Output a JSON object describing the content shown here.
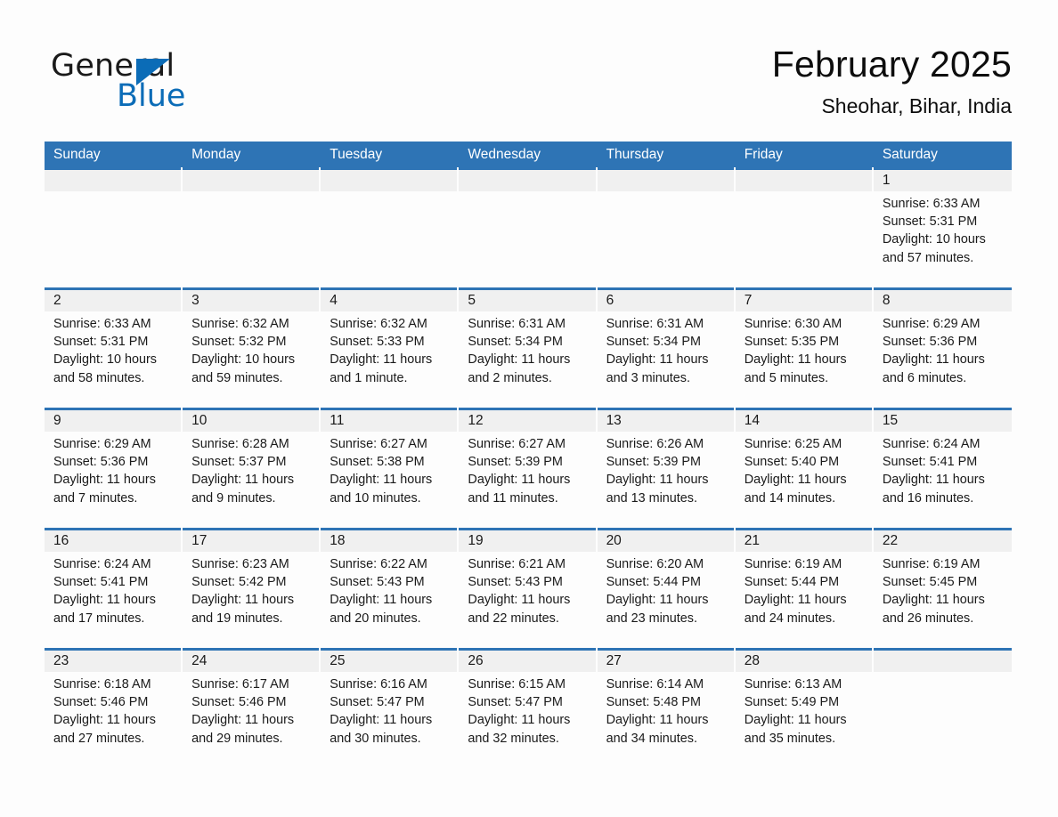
{
  "logo": {
    "text_primary": "General",
    "text_secondary": "Blue",
    "triangle_color": "#0b6cb7"
  },
  "header": {
    "title": "February 2025",
    "subtitle": "Sheohar, Bihar, India"
  },
  "theme": {
    "header_blue": "#2e74b5",
    "date_strip_gray": "#f0f0f0",
    "page_background": "#fdfdfd",
    "text_color": "#1a1a1a"
  },
  "weekdays": [
    "Sunday",
    "Monday",
    "Tuesday",
    "Wednesday",
    "Thursday",
    "Friday",
    "Saturday"
  ],
  "labels": {
    "sunrise_prefix": "Sunrise:",
    "sunset_prefix": "Sunset:",
    "daylight_prefix": "Daylight:"
  },
  "weeks": [
    [
      {
        "day": "",
        "sunrise": "",
        "sunset": "",
        "daylight": ""
      },
      {
        "day": "",
        "sunrise": "",
        "sunset": "",
        "daylight": ""
      },
      {
        "day": "",
        "sunrise": "",
        "sunset": "",
        "daylight": ""
      },
      {
        "day": "",
        "sunrise": "",
        "sunset": "",
        "daylight": ""
      },
      {
        "day": "",
        "sunrise": "",
        "sunset": "",
        "daylight": ""
      },
      {
        "day": "",
        "sunrise": "",
        "sunset": "",
        "daylight": ""
      },
      {
        "day": "1",
        "sunrise": "Sunrise: 6:33 AM",
        "sunset": "Sunset: 5:31 PM",
        "daylight": "Daylight: 10 hours and 57 minutes."
      }
    ],
    [
      {
        "day": "2",
        "sunrise": "Sunrise: 6:33 AM",
        "sunset": "Sunset: 5:31 PM",
        "daylight": "Daylight: 10 hours and 58 minutes."
      },
      {
        "day": "3",
        "sunrise": "Sunrise: 6:32 AM",
        "sunset": "Sunset: 5:32 PM",
        "daylight": "Daylight: 10 hours and 59 minutes."
      },
      {
        "day": "4",
        "sunrise": "Sunrise: 6:32 AM",
        "sunset": "Sunset: 5:33 PM",
        "daylight": "Daylight: 11 hours and 1 minute."
      },
      {
        "day": "5",
        "sunrise": "Sunrise: 6:31 AM",
        "sunset": "Sunset: 5:34 PM",
        "daylight": "Daylight: 11 hours and 2 minutes."
      },
      {
        "day": "6",
        "sunrise": "Sunrise: 6:31 AM",
        "sunset": "Sunset: 5:34 PM",
        "daylight": "Daylight: 11 hours and 3 minutes."
      },
      {
        "day": "7",
        "sunrise": "Sunrise: 6:30 AM",
        "sunset": "Sunset: 5:35 PM",
        "daylight": "Daylight: 11 hours and 5 minutes."
      },
      {
        "day": "8",
        "sunrise": "Sunrise: 6:29 AM",
        "sunset": "Sunset: 5:36 PM",
        "daylight": "Daylight: 11 hours and 6 minutes."
      }
    ],
    [
      {
        "day": "9",
        "sunrise": "Sunrise: 6:29 AM",
        "sunset": "Sunset: 5:36 PM",
        "daylight": "Daylight: 11 hours and 7 minutes."
      },
      {
        "day": "10",
        "sunrise": "Sunrise: 6:28 AM",
        "sunset": "Sunset: 5:37 PM",
        "daylight": "Daylight: 11 hours and 9 minutes."
      },
      {
        "day": "11",
        "sunrise": "Sunrise: 6:27 AM",
        "sunset": "Sunset: 5:38 PM",
        "daylight": "Daylight: 11 hours and 10 minutes."
      },
      {
        "day": "12",
        "sunrise": "Sunrise: 6:27 AM",
        "sunset": "Sunset: 5:39 PM",
        "daylight": "Daylight: 11 hours and 11 minutes."
      },
      {
        "day": "13",
        "sunrise": "Sunrise: 6:26 AM",
        "sunset": "Sunset: 5:39 PM",
        "daylight": "Daylight: 11 hours and 13 minutes."
      },
      {
        "day": "14",
        "sunrise": "Sunrise: 6:25 AM",
        "sunset": "Sunset: 5:40 PM",
        "daylight": "Daylight: 11 hours and 14 minutes."
      },
      {
        "day": "15",
        "sunrise": "Sunrise: 6:24 AM",
        "sunset": "Sunset: 5:41 PM",
        "daylight": "Daylight: 11 hours and 16 minutes."
      }
    ],
    [
      {
        "day": "16",
        "sunrise": "Sunrise: 6:24 AM",
        "sunset": "Sunset: 5:41 PM",
        "daylight": "Daylight: 11 hours and 17 minutes."
      },
      {
        "day": "17",
        "sunrise": "Sunrise: 6:23 AM",
        "sunset": "Sunset: 5:42 PM",
        "daylight": "Daylight: 11 hours and 19 minutes."
      },
      {
        "day": "18",
        "sunrise": "Sunrise: 6:22 AM",
        "sunset": "Sunset: 5:43 PM",
        "daylight": "Daylight: 11 hours and 20 minutes."
      },
      {
        "day": "19",
        "sunrise": "Sunrise: 6:21 AM",
        "sunset": "Sunset: 5:43 PM",
        "daylight": "Daylight: 11 hours and 22 minutes."
      },
      {
        "day": "20",
        "sunrise": "Sunrise: 6:20 AM",
        "sunset": "Sunset: 5:44 PM",
        "daylight": "Daylight: 11 hours and 23 minutes."
      },
      {
        "day": "21",
        "sunrise": "Sunrise: 6:19 AM",
        "sunset": "Sunset: 5:44 PM",
        "daylight": "Daylight: 11 hours and 24 minutes."
      },
      {
        "day": "22",
        "sunrise": "Sunrise: 6:19 AM",
        "sunset": "Sunset: 5:45 PM",
        "daylight": "Daylight: 11 hours and 26 minutes."
      }
    ],
    [
      {
        "day": "23",
        "sunrise": "Sunrise: 6:18 AM",
        "sunset": "Sunset: 5:46 PM",
        "daylight": "Daylight: 11 hours and 27 minutes."
      },
      {
        "day": "24",
        "sunrise": "Sunrise: 6:17 AM",
        "sunset": "Sunset: 5:46 PM",
        "daylight": "Daylight: 11 hours and 29 minutes."
      },
      {
        "day": "25",
        "sunrise": "Sunrise: 6:16 AM",
        "sunset": "Sunset: 5:47 PM",
        "daylight": "Daylight: 11 hours and 30 minutes."
      },
      {
        "day": "26",
        "sunrise": "Sunrise: 6:15 AM",
        "sunset": "Sunset: 5:47 PM",
        "daylight": "Daylight: 11 hours and 32 minutes."
      },
      {
        "day": "27",
        "sunrise": "Sunrise: 6:14 AM",
        "sunset": "Sunset: 5:48 PM",
        "daylight": "Daylight: 11 hours and 34 minutes."
      },
      {
        "day": "28",
        "sunrise": "Sunrise: 6:13 AM",
        "sunset": "Sunset: 5:49 PM",
        "daylight": "Daylight: 11 hours and 35 minutes."
      },
      {
        "day": "",
        "sunrise": "",
        "sunset": "",
        "daylight": ""
      }
    ]
  ]
}
